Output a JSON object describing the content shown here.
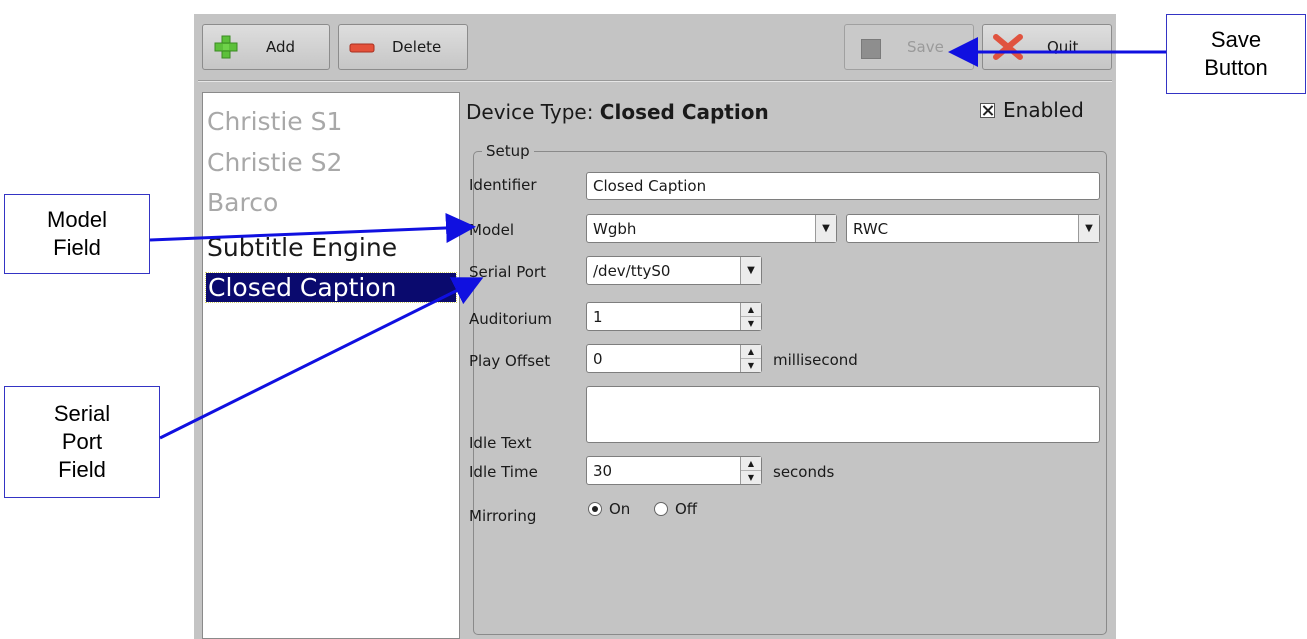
{
  "toolbar": {
    "add_label": "Add",
    "delete_label": "Delete",
    "save_label": "Save",
    "quit_label": "Quit"
  },
  "device_list": {
    "items": [
      {
        "label": "Christie S1",
        "state": "dim"
      },
      {
        "label": "Christie S2",
        "state": "dim"
      },
      {
        "label": "Barco",
        "state": "dim"
      },
      {
        "label": "Subtitle Engine",
        "state": "normal"
      },
      {
        "label": "Closed Caption",
        "state": "selected"
      }
    ]
  },
  "device_type": {
    "prefix": "Device Type:",
    "value": "Closed Caption"
  },
  "enabled": {
    "label": "Enabled",
    "checked": true
  },
  "setup": {
    "title": "Setup",
    "identifier_label": "Identifier",
    "identifier_value": "Closed Caption",
    "model_label": "Model",
    "model_value": "Wgbh",
    "model_variant_value": "RWC",
    "serial_label": "Serial Port",
    "serial_value": "/dev/ttyS0",
    "auditorium_label": "Auditorium",
    "auditorium_value": "1",
    "play_offset_label": "Play Offset",
    "play_offset_value": "0",
    "play_offset_unit": "millisecond",
    "idle_text_label": "Idle Text",
    "idle_text_value": "",
    "idle_time_label": "Idle Time",
    "idle_time_value": "30",
    "idle_time_unit": "seconds",
    "mirroring_label": "Mirroring",
    "mirroring_on": "On",
    "mirroring_off": "Off",
    "mirroring_selected": "On"
  },
  "callouts": {
    "save": "Save Button",
    "save_line1": "Save",
    "save_line2": "Button",
    "model_line1": "Model",
    "model_line2": "Field",
    "serial_line1": "Serial",
    "serial_line2": "Port",
    "serial_line3": "Field"
  },
  "colors": {
    "panel": "#c4c4c4",
    "selection": "#0a0a6e",
    "callout_arrow": "#1010e0"
  }
}
